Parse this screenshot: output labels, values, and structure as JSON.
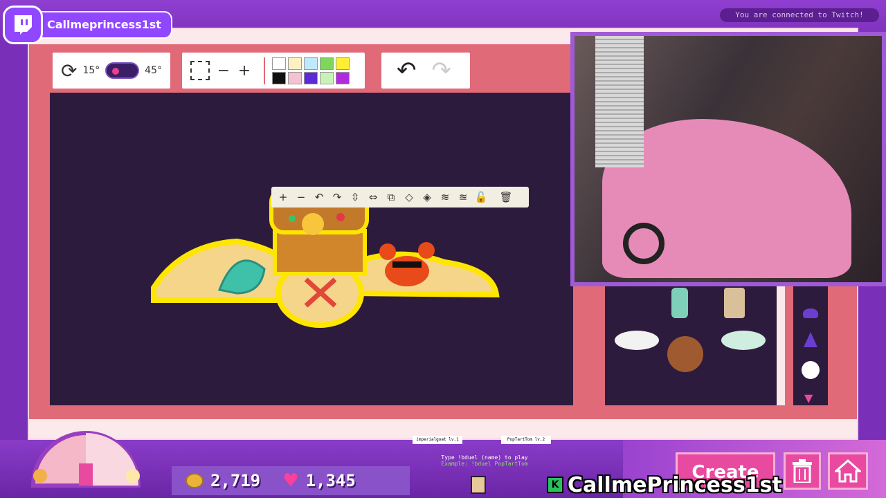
{
  "stream": {
    "streamer_name": "Callmeprincess1st",
    "connection_status": "You are connected to Twitch!",
    "kick_name": "CallmePrincess1st",
    "kick_badge": "K"
  },
  "toolbar": {
    "rotate_min": "15°",
    "rotate_max": "45°",
    "zoom_out": "−",
    "zoom_in": "+",
    "palette": [
      "#ffffff",
      "#fdf1c2",
      "#bfe9ff",
      "#7fd65c",
      "#ffee33",
      "#111111",
      "#f4c2d2",
      "#5b2bd6",
      "#c9f2b8",
      "#b02be0"
    ]
  },
  "object_toolbar": {
    "icons": [
      "zoom-in-icon",
      "zoom-out-icon",
      "rotate-left-icon",
      "rotate-right-icon",
      "flip-vertical-icon",
      "flip-horizontal-icon",
      "duplicate-icon",
      "layer-up-icon",
      "layer-down-icon",
      "bring-front-icon",
      "send-back-icon",
      "lock-icon",
      "delete-icon"
    ],
    "glyphs": [
      "+",
      "−",
      "↶",
      "↷",
      "⇳",
      "⇔",
      "⧉",
      "◇",
      "◈",
      "≋",
      "≊",
      "🔓",
      "🗑"
    ]
  },
  "hud": {
    "coins": "2,719",
    "hearts": "1,345",
    "create_label": "Create",
    "duel_hint": "Type !bduel (name) to play",
    "duel_example": "Example: !bduel PopTartTom",
    "duel_player1": "imperialgoat lv.1",
    "duel_player2": "PopTartTom lv.2"
  },
  "colors": {
    "accent_purple": "#9147ff",
    "frame_pink": "#e06a78",
    "canvas_dark": "#2d1b3d",
    "button_pink": "#e84aa0"
  }
}
